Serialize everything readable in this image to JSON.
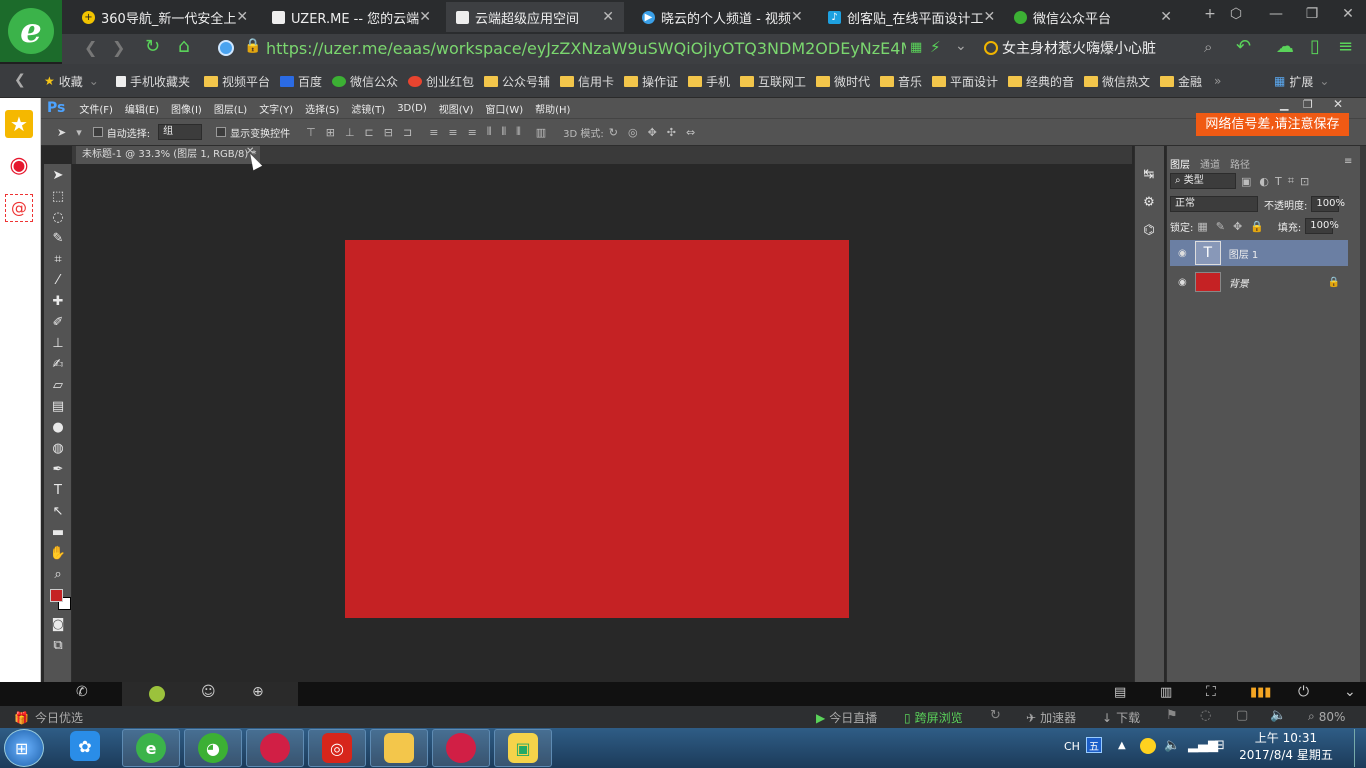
{
  "browser": {
    "tabs": [
      {
        "label": "360导航_新一代安全上",
        "icon": "plus-icon",
        "active": false
      },
      {
        "label": "UZER.ME -- 您的云端",
        "icon": "doc-icon",
        "active": false
      },
      {
        "label": "云端超级应用空间",
        "icon": "doc-icon",
        "active": true
      },
      {
        "label": "晓云的个人频道 - 视频",
        "icon": "play-icon",
        "active": false
      },
      {
        "label": "创客贴_在线平面设计工",
        "icon": "feather-icon",
        "active": false
      },
      {
        "label": "微信公众平台",
        "icon": "wechat-icon",
        "active": false
      }
    ],
    "url": "https://uzer.me/eaas/workspace/eyJzZXNzaW9uSWQiOjIyOTQ3NDM2ODEyNzE4MDgsIn",
    "search_hint": "女主身材惹火嗨爆小心脏",
    "bookmarks": [
      {
        "label": "收藏",
        "icon": "star-icon"
      },
      {
        "label": "手机收藏夹",
        "icon": "phone-icon"
      },
      {
        "label": "视频平台",
        "icon": "folder-icon"
      },
      {
        "label": "百度",
        "icon": "paw-icon"
      },
      {
        "label": "微信公众",
        "icon": "wechat-icon"
      },
      {
        "label": "创业红包",
        "icon": "redpack-icon"
      },
      {
        "label": "公众号辅",
        "icon": "folder-icon"
      },
      {
        "label": "信用卡",
        "icon": "folder-icon"
      },
      {
        "label": "操作证",
        "icon": "folder-icon"
      },
      {
        "label": "手机",
        "icon": "folder-icon"
      },
      {
        "label": "互联网工",
        "icon": "folder-icon"
      },
      {
        "label": "微时代",
        "icon": "folder-icon"
      },
      {
        "label": "音乐",
        "icon": "folder-icon"
      },
      {
        "label": "平面设计",
        "icon": "folder-icon"
      },
      {
        "label": "经典的音",
        "icon": "folder-icon"
      },
      {
        "label": "微信热文",
        "icon": "folder-icon"
      },
      {
        "label": "金融",
        "icon": "folder-icon"
      }
    ],
    "extensions_label": "扩展",
    "status_left": "今日优选",
    "status_items": [
      "今日直播",
      "跨屏浏览",
      "加速器",
      "下载"
    ],
    "zoom": "80%"
  },
  "photoshop": {
    "logo": "Ps",
    "menu": [
      "文件(F)",
      "编辑(E)",
      "图像(I)",
      "图层(L)",
      "文字(Y)",
      "选择(S)",
      "滤镜(T)",
      "3D(D)",
      "视图(V)",
      "窗口(W)",
      "帮助(H)"
    ],
    "options": {
      "auto_select_label": "自动选择:",
      "auto_select_value": "组",
      "show_transform_label": "显示变换控件",
      "mode3d_label": "3D 模式:"
    },
    "doc_tab": "未标题-1 @ 33.3% (图层 1, RGB/8) *",
    "notice": "网络信号差,请注意保存",
    "foreground_color": "#c52224",
    "canvas_color": "#c52224",
    "panel_tabs": [
      "图层",
      "通道",
      "路径"
    ],
    "filter_kind": "类型",
    "blend_mode": "正常",
    "opacity_label": "不透明度:",
    "opacity": "100%",
    "lock_label": "锁定:",
    "fill_label": "填充:",
    "fill": "100%",
    "layers": [
      {
        "name": "图层 1",
        "thumb": "T",
        "selected": true
      },
      {
        "name": "背景",
        "thumb": "",
        "selected": false,
        "locked": true
      }
    ]
  },
  "taskbar": {
    "input_lang": "CH",
    "time": "上午 10:31",
    "date": "2017/8/4 星期五"
  }
}
